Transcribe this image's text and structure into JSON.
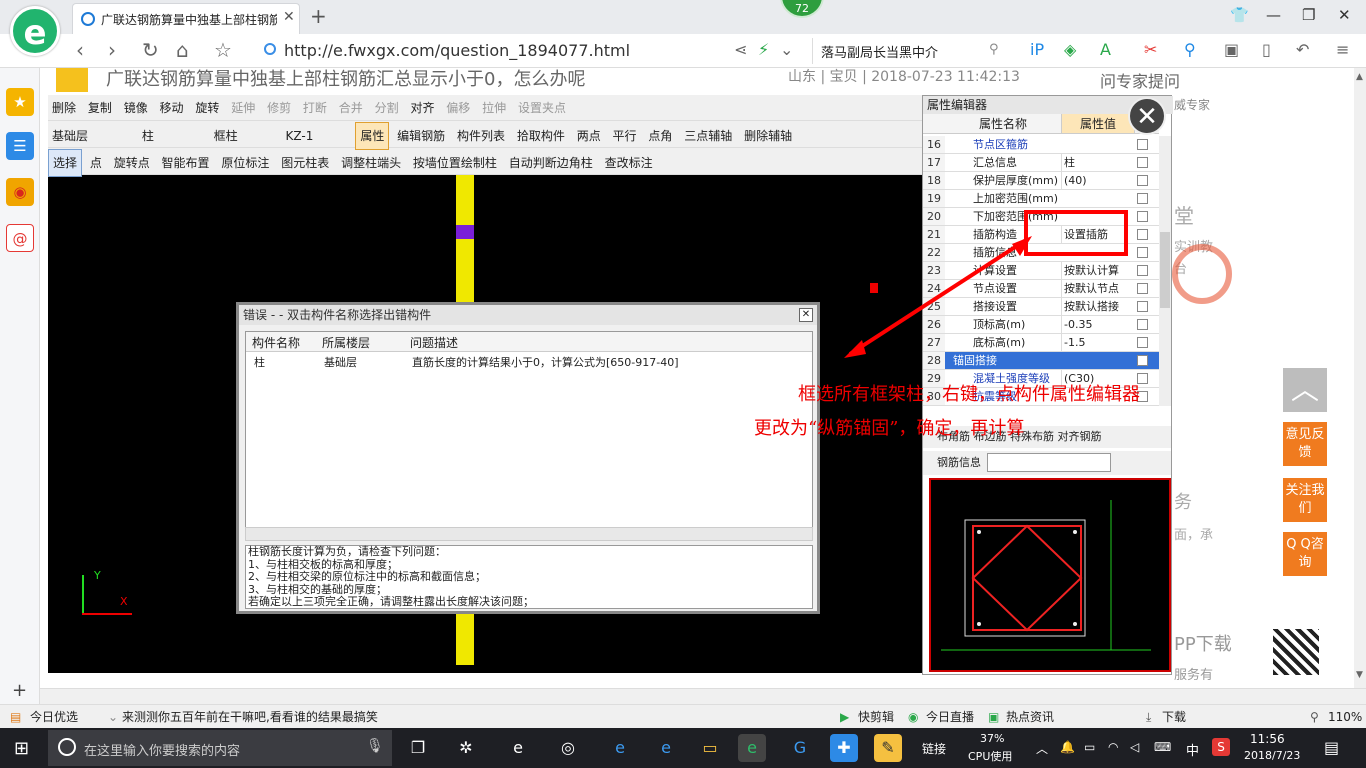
{
  "browser": {
    "tab_title": "广联达钢筋算量中独基上部柱钢筋",
    "badge_count": "72",
    "url": "http://e.fwxgx.com/question_1894077.html",
    "search_text": "落马副局长当黑中介",
    "brand_color": "#21b46e"
  },
  "page": {
    "heading": "广联达钢筋算量中独基上部柱钢筋汇总显示小于0，怎么办呢",
    "meta": "山东 | 宝贝 | 2018-07-23 11:42:13",
    "right_snippets": [
      "问专家提问",
      "威专家",
      "堂",
      "实训教",
      "台",
      "务",
      "面，承",
      "PP下载",
      "服务有"
    ],
    "float_buttons": [
      "意见反馈",
      "关注我们",
      "Q Q咨询"
    ]
  },
  "app": {
    "toolbar_row1": [
      "删除",
      "复制",
      "镜像",
      "移动",
      "旋转",
      "延伸",
      "修剪",
      "打断",
      "合并",
      "分割",
      "对齐",
      "偏移",
      "拉伸",
      "设置夹点"
    ],
    "toolbar_row2": [
      "基础层",
      "柱",
      "框柱",
      "KZ-1",
      "属性",
      "编辑钢筋",
      "构件列表",
      "拾取构件",
      "两点",
      "平行",
      "点角",
      "三点辅轴",
      "删除辅轴"
    ],
    "toolbar_row3": [
      "选择",
      "点",
      "旋转点",
      "智能布置",
      "原位标注",
      "图元柱表",
      "调整柱端头",
      "按墙位置绘制柱",
      "自动判断边角柱",
      "查改标注"
    ]
  },
  "props": {
    "title": "属性编辑器",
    "col_name": "属性名称",
    "col_value": "属性值",
    "col_attach": "附",
    "rows": [
      {
        "num": "16",
        "name": "节点区箍筋",
        "value": ""
      },
      {
        "num": "17",
        "name": "汇总信息",
        "value": "柱"
      },
      {
        "num": "18",
        "name": "保护层厚度(mm)",
        "value": "(40)"
      },
      {
        "num": "19",
        "name": "上加密范围(mm)",
        "value": ""
      },
      {
        "num": "20",
        "name": "下加密范围(mm)",
        "value": ""
      },
      {
        "num": "21",
        "name": "插筋构造",
        "value": "设置插筋"
      },
      {
        "num": "22",
        "name": "插筋信息",
        "value": ""
      },
      {
        "num": "23",
        "name": "计算设置",
        "value": "按默认计算"
      },
      {
        "num": "24",
        "name": "节点设置",
        "value": "按默认节点"
      },
      {
        "num": "25",
        "name": "搭接设置",
        "value": "按默认搭接"
      },
      {
        "num": "26",
        "name": "顶标高(m)",
        "value": "-0.35"
      },
      {
        "num": "27",
        "name": "底标高(m)",
        "value": "-1.5"
      },
      {
        "num": "28",
        "name": "锚固搭接",
        "value": ""
      },
      {
        "num": "29",
        "name": "混凝土强度等级",
        "value": "(C30)"
      },
      {
        "num": "30",
        "name": "抗震等级",
        "value": ""
      }
    ],
    "rebar_tabs": "布角筋  布边筋  特殊布筋  对齐钢筋",
    "rebar_info_label": "钢筋信息"
  },
  "error_dialog": {
    "title": "错误 - - 双击构件名称选择出错构件",
    "columns": [
      "构件名称",
      "所属楼层",
      "问题描述"
    ],
    "rows": [
      {
        "name": "柱",
        "floor": "基础层",
        "desc": "直筋长度的计算结果小于0，计算公式为[650-917-40]"
      }
    ],
    "help_lines": [
      "柱钢筋长度计算为负，请检查下列问题：",
      "1、与柱相交板的标高和厚度；",
      "2、与柱相交梁的原位标注中的标高和截面信息；",
      "3、与柱相交的基础的厚度；",
      "若确定以上三项完全正确，请调整柱露出长度解决该问题；"
    ]
  },
  "annotation": {
    "line1": "框选所有框架柱，右键，点构件属性编辑器",
    "line2": "更改为“纵筋锚固”，确定，再计算",
    "color": "#ee0000"
  },
  "statusbar": {
    "left_items": [
      "今日优选",
      "来测测你五百年前在干嘛吧,看看谁的结果最搞笑"
    ],
    "right_items": [
      "快剪辑",
      "今日直播",
      "热点资讯",
      "下载",
      "110%"
    ]
  },
  "taskbar": {
    "search_placeholder": "在这里输入你要搜索的内容",
    "link_label": "链接",
    "cpu_percent": "37%",
    "cpu_label": "CPU使用",
    "ime": "中",
    "time": "11:56",
    "date": "2018/7/23"
  }
}
